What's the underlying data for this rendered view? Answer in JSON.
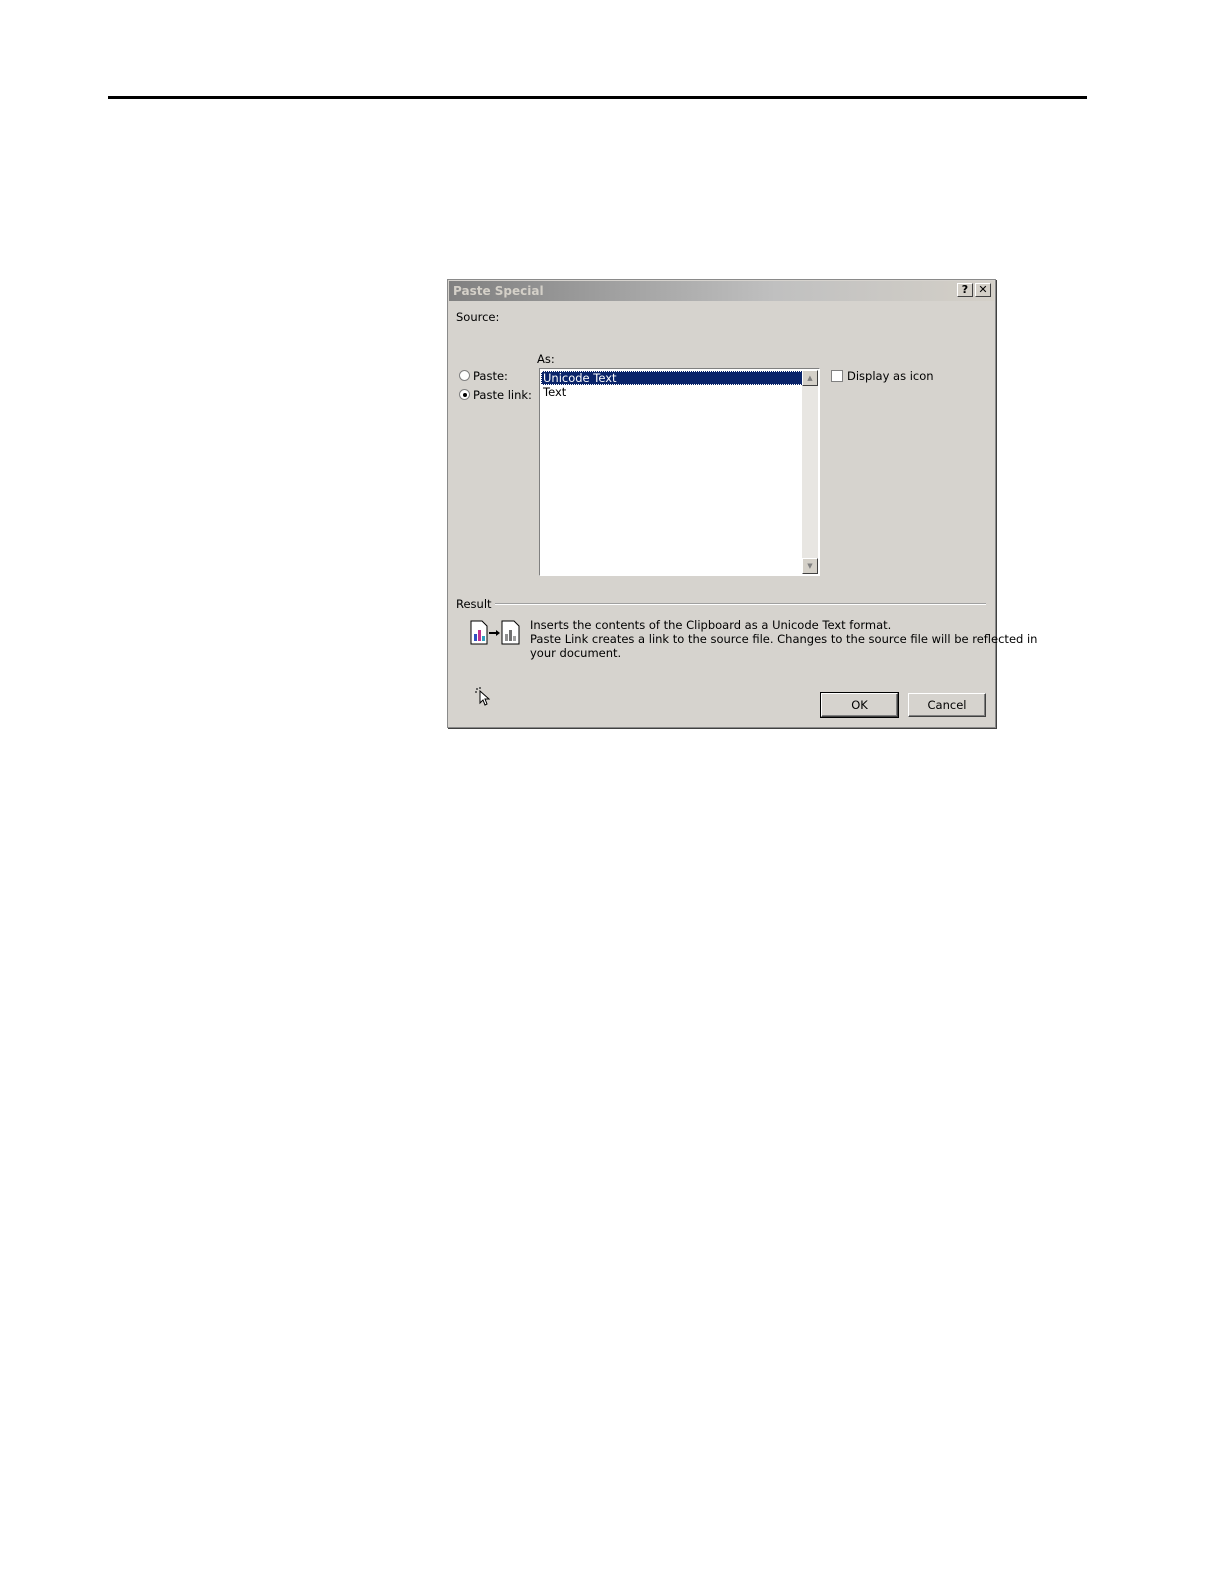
{
  "dialog": {
    "title": "Paste Special",
    "help_glyph": "?",
    "close_glyph": "✕",
    "source_label": "Source:",
    "as_label": "As:",
    "options": {
      "paste_label": "Paste:",
      "paste_link_label": "Paste link:",
      "selected": "paste_link"
    },
    "formats": [
      "Unicode Text",
      "Text"
    ],
    "selected_format": "Unicode Text",
    "display_as_icon_label": "Display as icon",
    "display_as_icon_checked": false,
    "result": {
      "label": "Result",
      "line1": "Inserts the contents of the Clipboard as a Unicode Text format.",
      "line2": "Paste Link creates a link to the source file. Changes to the source file will be reflected in",
      "line3": "your document."
    },
    "buttons": {
      "ok": "OK",
      "cancel": "Cancel"
    }
  }
}
